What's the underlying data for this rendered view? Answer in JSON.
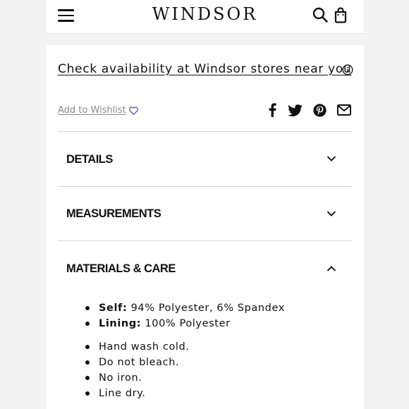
{
  "header": {
    "brand": "WINDSOR",
    "icons": [
      "hamburger-menu-icon",
      "search-icon",
      "shopping-bag-icon"
    ]
  },
  "availability": {
    "link_text": "Check availability at Windsor stores near you",
    "info_icon": "info-icon"
  },
  "wishlist": {
    "label": "Add to Wishlist",
    "icon": "heart-icon"
  },
  "share_icons": [
    "facebook-icon",
    "twitter-icon",
    "pinterest-icon",
    "email-icon"
  ],
  "accordion": [
    {
      "title": "DETAILS",
      "expanded": false
    },
    {
      "title": "MEASUREMENTS",
      "expanded": false
    },
    {
      "title": "MATERIALS & CARE",
      "expanded": true
    }
  ],
  "materials": [
    {
      "label": "Self:",
      "value": "94% Polyester, 6% Spandex"
    },
    {
      "label": "Lining:",
      "value": "100% Polyester"
    }
  ],
  "care": [
    "Hand wash cold.",
    "Do not bleach.",
    "No iron.",
    "Line dry."
  ],
  "colors": {
    "wishlist_heart": "#6a4fc4",
    "text": "#111111",
    "muted": "#8a8a8a"
  }
}
